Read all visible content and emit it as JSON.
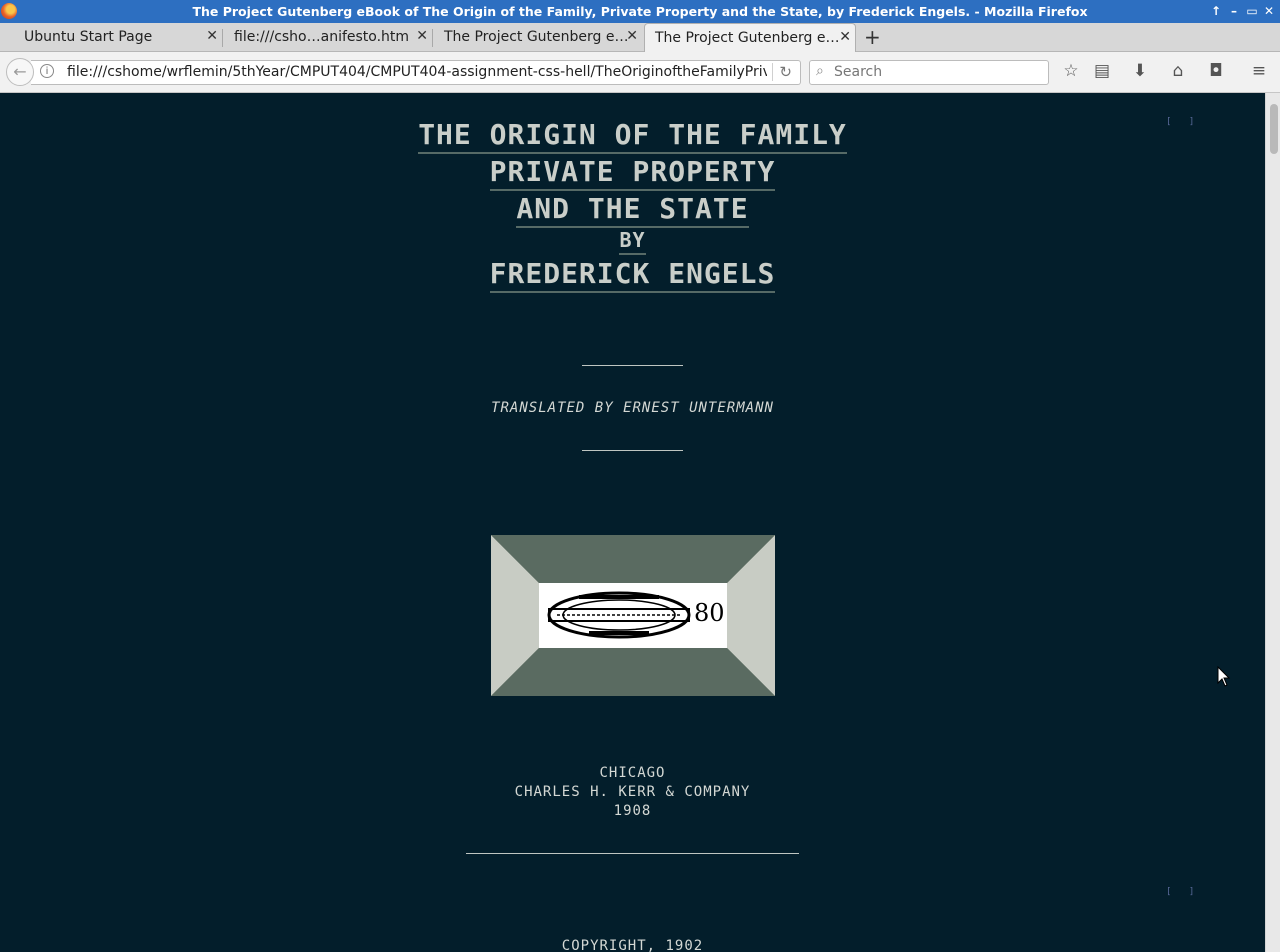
{
  "window": {
    "title": "The Project Gutenberg eBook of The Origin of the Family, Private Property and the State, by Frederick Engels. - Mozilla Firefox"
  },
  "tabs": [
    {
      "label": "Ubuntu Start Page",
      "active": false
    },
    {
      "label": "file:///csho…anifesto.htm",
      "active": false
    },
    {
      "label": "The Project Gutenberg e…",
      "active": false
    },
    {
      "label": "The Project Gutenberg e…",
      "active": true
    }
  ],
  "navbar": {
    "url": "file:///cshome/wrflemin/5thYear/CMPUT404/CMPUT404-assignment-css-hell/TheOriginoftheFamilyPrivate",
    "search_placeholder": "Search"
  },
  "page": {
    "page_number_marker_1": "[ ]",
    "page_number_marker_2": "[ ]",
    "title_lines": [
      "THE ORIGIN OF THE FAMILY",
      "PRIVATE PROPERTY",
      "AND THE STATE"
    ],
    "by": "BY",
    "author": "FREDERICK ENGELS",
    "translated": "TRANSLATED BY ERNEST UNTERMANN",
    "stamp_number": "80",
    "publisher_city": "CHICAGO",
    "publisher_name": "CHARLES H. KERR & COMPANY",
    "publisher_year": "1908",
    "copyright": "COPYRIGHT, 1902"
  },
  "colors": {
    "page_background": "#031e2b",
    "text": "#d4d8d4",
    "titlebar": "#2d6fc1"
  }
}
